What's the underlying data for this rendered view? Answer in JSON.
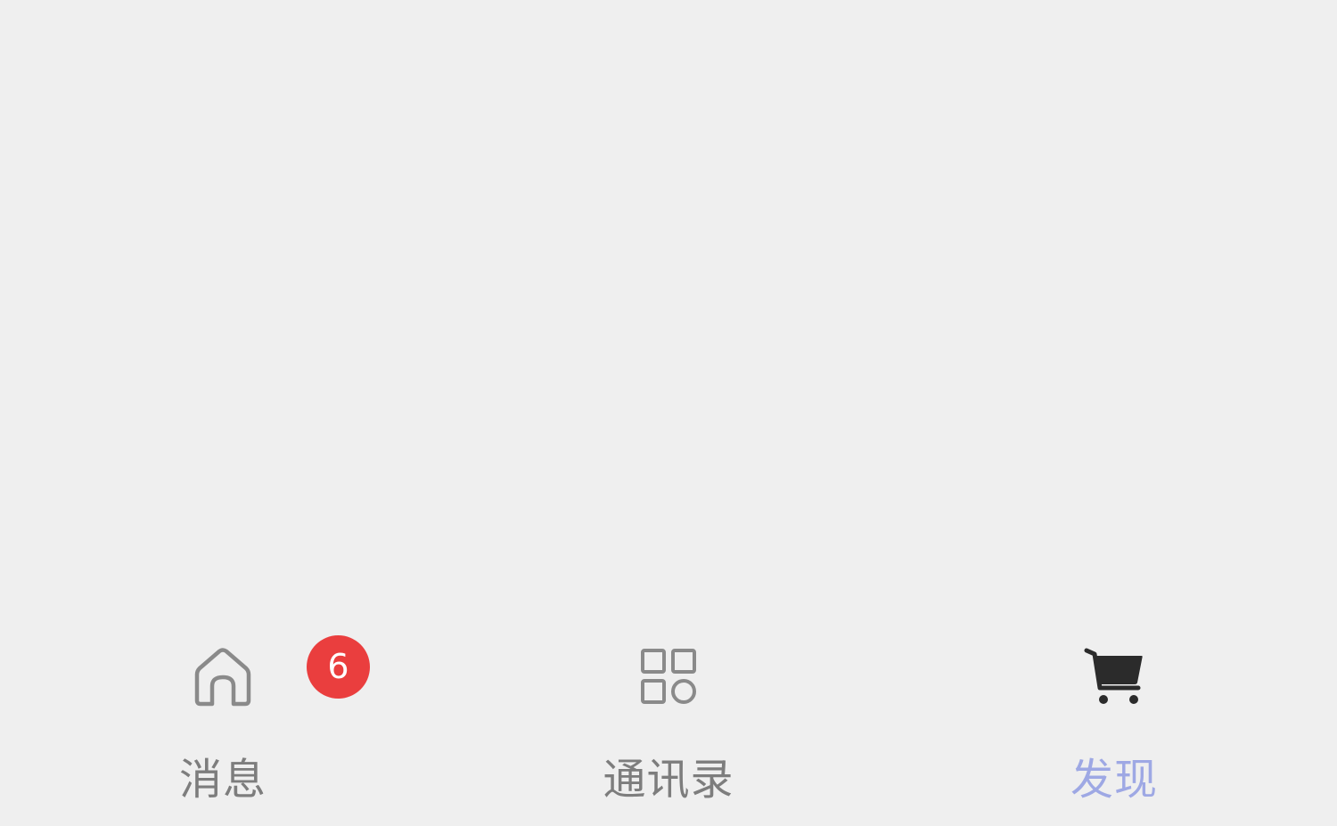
{
  "tabbar": {
    "tabs": [
      {
        "label": "消息",
        "icon": "home-icon",
        "active": false,
        "badge": "6"
      },
      {
        "label": "通讯录",
        "icon": "grid-icon",
        "active": false
      },
      {
        "label": "发现",
        "icon": "cart-icon",
        "active": true
      }
    ]
  },
  "colors": {
    "background": "#efefef",
    "inactive_label": "#7d7d7d",
    "active_label": "#9ea8e4",
    "badge": "#ea3e3e",
    "icon_outline": "#8a8a8a",
    "cart_icon": "#2b2b2b"
  }
}
